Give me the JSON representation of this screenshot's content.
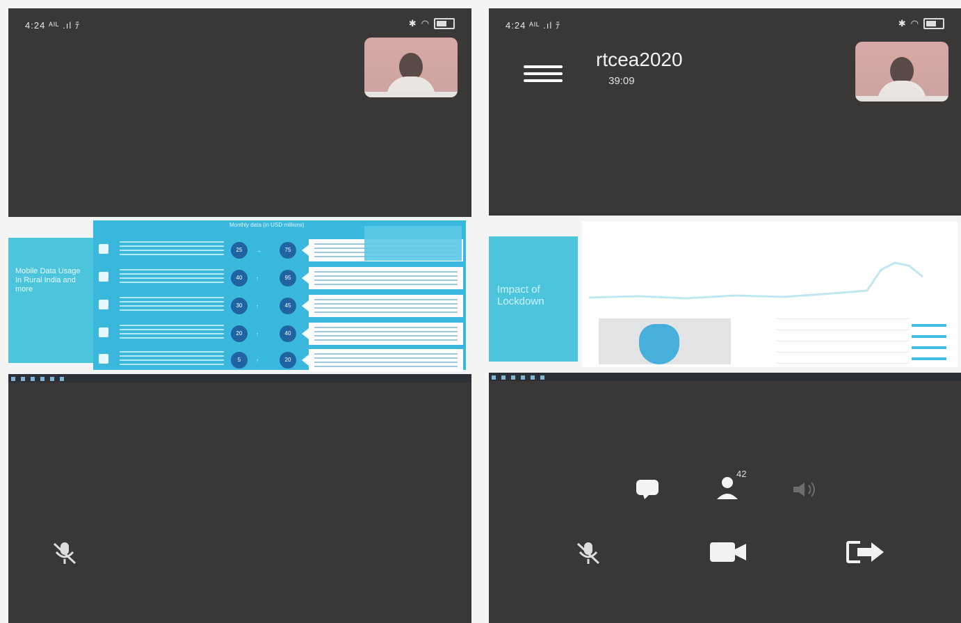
{
  "left_phone": {
    "status_time": "4:24",
    "status_signal": "ᴬᴵᴸ .ıl ﾃ",
    "icons": [
      "bluetooth-icon",
      "headphone-icon",
      "battery-icon"
    ],
    "slide": {
      "side_text": "Mobile Data Usage In Rural India and more",
      "header": "Monthly data (in USD millions)",
      "rows": [
        {
          "left": "25",
          "right": "75"
        },
        {
          "left": "40",
          "right": "95"
        },
        {
          "left": "30",
          "right": "45"
        },
        {
          "left": "20",
          "right": "40"
        },
        {
          "left": "5",
          "right": "20"
        }
      ]
    },
    "controls": {
      "mic": "mic-muted-icon"
    }
  },
  "right_phone": {
    "status_time": "4:24",
    "status_signal": "ᴬᴵᴸ .ıl ﾃ",
    "meeting_title": "rtcea2020",
    "timer": "39:09",
    "slide": {
      "side_text": "Impact of Lockdown"
    },
    "controls": {
      "chat": "chat-icon",
      "participants_count": "42",
      "speaker": "speaker-icon",
      "mic": "mic-muted-icon",
      "video": "video-icon",
      "leave": "leave-icon"
    }
  }
}
